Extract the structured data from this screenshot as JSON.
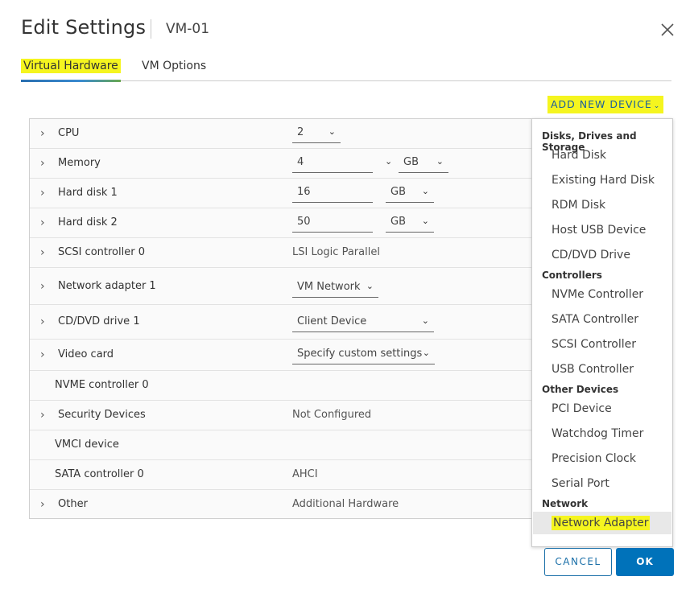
{
  "dialog": {
    "title": "Edit Settings",
    "vm_name": "VM-01"
  },
  "tabs": [
    {
      "label": "Virtual Hardware",
      "active": true
    },
    {
      "label": "VM Options",
      "active": false
    }
  ],
  "add_device": {
    "label": "ADD NEW DEVICE",
    "chevron": "⌄"
  },
  "hardware": {
    "cpu": {
      "label": "CPU",
      "value": "2"
    },
    "memory": {
      "label": "Memory",
      "value": "4",
      "unit": "GB"
    },
    "hard_disk_1": {
      "label": "Hard disk 1",
      "value": "16",
      "unit": "GB"
    },
    "hard_disk_2": {
      "label": "Hard disk 2",
      "value": "50",
      "unit": "GB"
    },
    "scsi": {
      "label": "SCSI controller 0",
      "value": "LSI Logic Parallel"
    },
    "network_adapter": {
      "label": "Network adapter 1",
      "value": "VM Network"
    },
    "cd_dvd": {
      "label": "CD/DVD drive 1",
      "value": "Client Device"
    },
    "video_card": {
      "label": "Video card",
      "value": "Specify custom settings"
    },
    "nvme": {
      "label": "NVME controller 0"
    },
    "security": {
      "label": "Security Devices",
      "value": "Not Configured"
    },
    "vmci": {
      "label": "VMCI device"
    },
    "sata": {
      "label": "SATA controller 0",
      "value": "AHCI"
    },
    "other": {
      "label": "Other",
      "value": "Additional Hardware"
    }
  },
  "add_menu": {
    "disks_header": "Disks, Drives and Storage",
    "hard_disk": "Hard Disk",
    "existing_hard_disk": "Existing Hard Disk",
    "rdm_disk": "RDM Disk",
    "host_usb": "Host USB Device",
    "cd_dvd_drive": "CD/DVD Drive",
    "controllers_header": "Controllers",
    "nvme_controller": "NVMe Controller",
    "sata_controller": "SATA Controller",
    "scsi_controller": "SCSI Controller",
    "usb_controller": "USB Controller",
    "other_header": "Other Devices",
    "pci_device": "PCI Device",
    "watchdog_timer": "Watchdog Timer",
    "precision_clock": "Precision Clock",
    "serial_port": "Serial Port",
    "network_header": "Network",
    "network_adapter": "Network Adapter"
  },
  "footer": {
    "cancel_label": "CANCEL",
    "ok_label": "OK"
  },
  "colors": {
    "highlight": "#f5f51f",
    "accent": "#0072ba",
    "link": "#1a5e9e"
  },
  "icons": {
    "close": "close-icon",
    "expand": "chevron-right-icon",
    "dropdown": "chevron-down-icon"
  }
}
